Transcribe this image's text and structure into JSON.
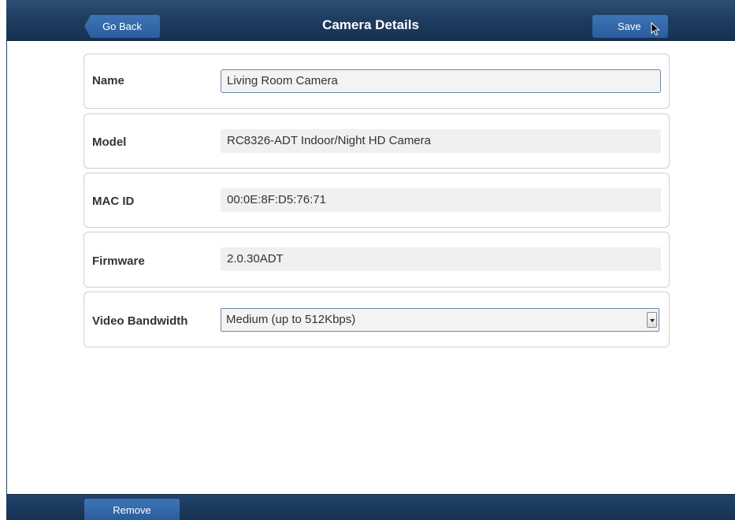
{
  "header": {
    "title": "Camera Details",
    "back_label": "Go Back",
    "save_label": "Save"
  },
  "fields": {
    "name": {
      "label": "Name",
      "value": "Living Room Camera"
    },
    "model": {
      "label": "Model",
      "value": "RC8326-ADT Indoor/Night HD Camera"
    },
    "mac": {
      "label": "MAC ID",
      "value": "00:0E:8F:D5:76:71"
    },
    "firmware": {
      "label": "Firmware",
      "value": "2.0.30ADT"
    },
    "bandwidth": {
      "label": "Video Bandwidth",
      "value": "Medium (up to 512Kbps)"
    }
  },
  "footer": {
    "remove_label": "Remove"
  },
  "colors": {
    "header_bg": "#1f3d61",
    "button_bg": "#2a5d9e",
    "row_border": "#d0d0d0",
    "input_border": "#6c87a8"
  },
  "icons": {
    "cursor": "mouse-pointer-icon",
    "dropdown": "chevron-down-icon"
  }
}
